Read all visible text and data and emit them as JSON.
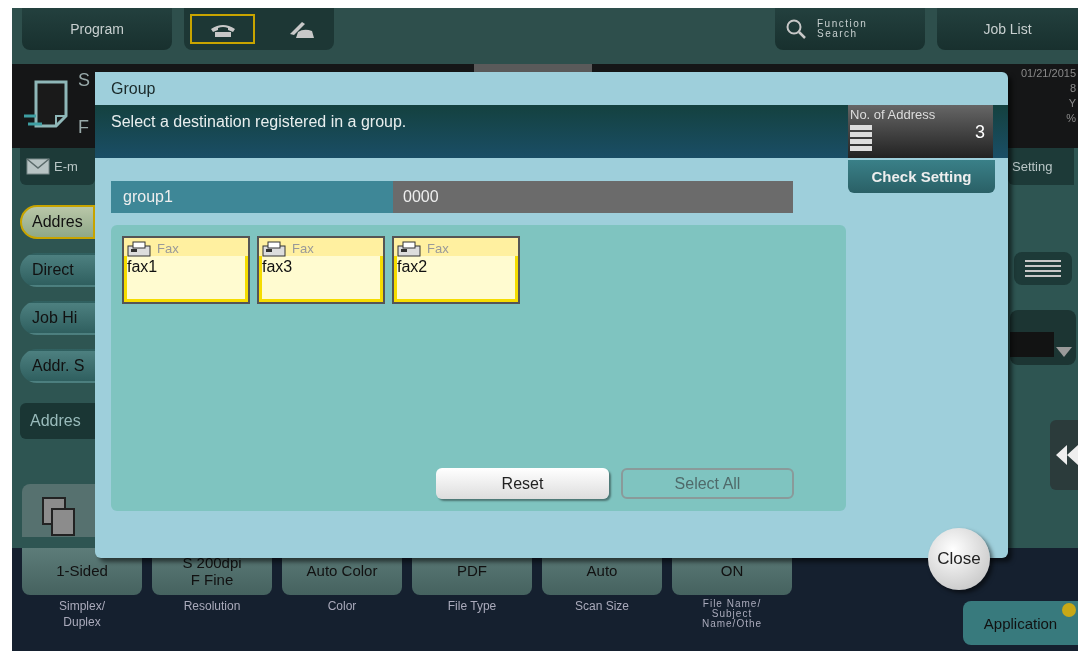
{
  "top_bar": {
    "program_button": "Program",
    "mode_tabs": [
      {
        "kind": "handset",
        "selected": true
      },
      {
        "kind": "hook",
        "selected": false
      }
    ],
    "function_search": "Function\nSearch",
    "job_list": "Job List"
  },
  "info_bar": {
    "line_1": "S",
    "line_2": "F",
    "status_lines": [
      "01/21/2015",
      "8",
      "Y",
      "%"
    ]
  },
  "left_panel": {
    "email_button": "E-m",
    "nav": [
      {
        "label": "Addres",
        "selected": true
      },
      {
        "label": "Direct",
        "selected": false
      },
      {
        "label": "Job Hi",
        "selected": false
      },
      {
        "label": "Addr. S",
        "selected": false
      }
    ],
    "search_button": "Addres"
  },
  "right_panel": {
    "setting_button": "Setting"
  },
  "settings": [
    {
      "value": "1-Sided",
      "label": "Simplex/\nDuplex"
    },
    {
      "value": "S 200dpi\nF Fine",
      "label": "Resolution"
    },
    {
      "value": "Auto Color",
      "label": "Color"
    },
    {
      "value": "PDF",
      "label": "File Type"
    },
    {
      "value": "Auto",
      "label": "Scan Size"
    },
    {
      "value": "ON",
      "label": "File Name/\nSubject\nName/Othe"
    }
  ],
  "application_button": "Application",
  "dialog": {
    "title": "Group",
    "message": "Select a destination registered in a group.",
    "address_count": {
      "label": "No. of Address",
      "value": "3"
    },
    "check_setting": "Check Setting",
    "group": {
      "name": "group1",
      "number": "0000"
    },
    "destinations": [
      {
        "type": "Fax",
        "name": "fax1",
        "selected": true
      },
      {
        "type": "Fax",
        "name": "fax3",
        "selected": true
      },
      {
        "type": "Fax",
        "name": "fax2",
        "selected": true
      }
    ],
    "buttons": [
      {
        "label": "Reset",
        "disabled": false
      },
      {
        "label": "Select All",
        "disabled": true
      }
    ],
    "close": "Close"
  }
}
